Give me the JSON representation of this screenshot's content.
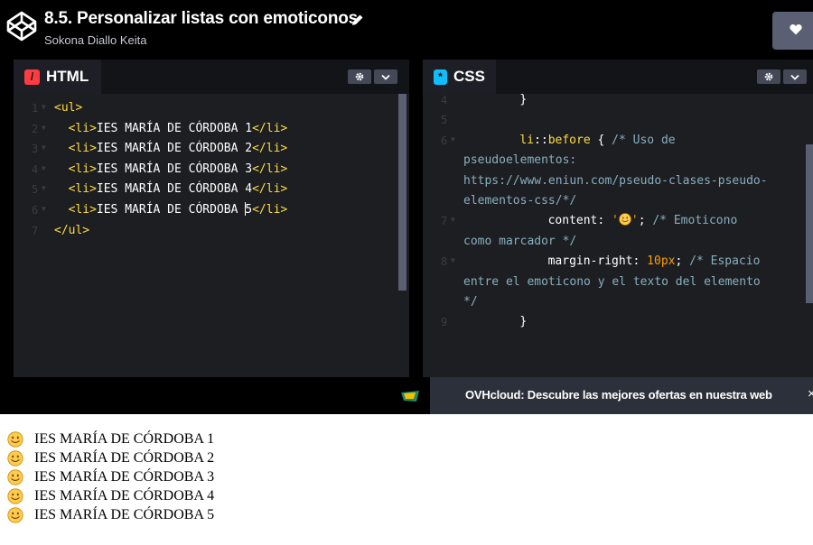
{
  "header": {
    "title": "8.5. Personalizar listas con emoticonos",
    "author": "Sokona Diallo Keita"
  },
  "html_panel": {
    "tab_label": "HTML",
    "icon_text": "/",
    "icon_color": "#ff3c41",
    "lines": [
      {
        "num": "1",
        "fold": true,
        "parts": [
          {
            "t": "<ul>",
            "c": "tag"
          }
        ],
        "indent": 0
      },
      {
        "num": "2",
        "fold": true,
        "parts": [
          {
            "t": "<li>",
            "c": "tag"
          },
          {
            "t": "IES MARÍA DE CÓRDOBA 1",
            "c": "val"
          },
          {
            "t": "</li>",
            "c": "tag"
          }
        ],
        "indent": 2
      },
      {
        "num": "3",
        "fold": true,
        "parts": [
          {
            "t": "<li>",
            "c": "tag"
          },
          {
            "t": "IES MARÍA DE CÓRDOBA 2",
            "c": "val"
          },
          {
            "t": "</li>",
            "c": "tag"
          }
        ],
        "indent": 2
      },
      {
        "num": "4",
        "fold": true,
        "parts": [
          {
            "t": "<li>",
            "c": "tag"
          },
          {
            "t": "IES MARÍA DE CÓRDOBA 3",
            "c": "val"
          },
          {
            "t": "</li>",
            "c": "tag"
          }
        ],
        "indent": 2
      },
      {
        "num": "5",
        "fold": true,
        "parts": [
          {
            "t": "<li>",
            "c": "tag"
          },
          {
            "t": "IES MARÍA DE CÓRDOBA 4",
            "c": "val"
          },
          {
            "t": "</li>",
            "c": "tag"
          }
        ],
        "indent": 2
      },
      {
        "num": "6",
        "fold": true,
        "parts": [
          {
            "t": "<li>",
            "c": "tag"
          },
          {
            "t": "IES MARÍA DE CÓRDOBA ",
            "c": "val"
          },
          {
            "t": "|",
            "c": "caret"
          },
          {
            "t": "5",
            "c": "val"
          },
          {
            "t": "</li>",
            "c": "tag"
          }
        ],
        "indent": 2
      },
      {
        "num": "7",
        "fold": false,
        "parts": [
          {
            "t": "</ul>",
            "c": "tag"
          }
        ],
        "indent": 0
      }
    ]
  },
  "css_panel": {
    "tab_label": "CSS",
    "icon_text": "*",
    "icon_color": "#0ebeff",
    "lines": [
      {
        "num": "4",
        "fold": false,
        "parts": [
          {
            "t": "}",
            "c": "val"
          }
        ],
        "indent": 8
      },
      {
        "num": "5",
        "fold": false,
        "parts": [],
        "indent": 0
      },
      {
        "num": "6",
        "fold": true,
        "parts": [
          {
            "t": "li",
            "c": "sel"
          },
          {
            "t": "::",
            "c": "val"
          },
          {
            "t": "before",
            "c": "sel"
          },
          {
            "t": " { ",
            "c": "val"
          },
          {
            "t": "/* Uso de",
            "c": "comment"
          }
        ],
        "indent": 8
      },
      {
        "num": "",
        "fold": false,
        "parts": [
          {
            "t": "pseudoelementos:",
            "c": "comment"
          }
        ],
        "indent": 0
      },
      {
        "num": "",
        "fold": false,
        "parts": [
          {
            "t": "https://www.eniun.com/pseudo-clases-pseudo-",
            "c": "comment"
          }
        ],
        "indent": 0
      },
      {
        "num": "",
        "fold": false,
        "parts": [
          {
            "t": "elementos-css/*/",
            "c": "comment"
          }
        ],
        "indent": 0
      },
      {
        "num": "7",
        "fold": true,
        "parts": [
          {
            "t": "content: ",
            "c": "prop"
          },
          {
            "t": "'",
            "c": "num"
          },
          {
            "t": "EMOJI",
            "c": "emoji"
          },
          {
            "t": "'",
            "c": "num"
          },
          {
            "t": "; ",
            "c": "val"
          },
          {
            "t": "/* Emoticono",
            "c": "comment"
          }
        ],
        "indent": 12
      },
      {
        "num": "",
        "fold": false,
        "parts": [
          {
            "t": "como marcador */",
            "c": "comment"
          }
        ],
        "indent": 0
      },
      {
        "num": "8",
        "fold": true,
        "parts": [
          {
            "t": "margin-right: ",
            "c": "prop"
          },
          {
            "t": "10px",
            "c": "num"
          },
          {
            "t": "; ",
            "c": "val"
          },
          {
            "t": "/* Espacio",
            "c": "comment"
          }
        ],
        "indent": 12
      },
      {
        "num": "",
        "fold": false,
        "parts": [
          {
            "t": "entre el emoticono y el texto del elemento",
            "c": "comment"
          }
        ],
        "indent": 0
      },
      {
        "num": "",
        "fold": false,
        "parts": [
          {
            "t": "*/",
            "c": "comment"
          }
        ],
        "indent": 0
      },
      {
        "num": "9",
        "fold": false,
        "parts": [
          {
            "t": "}",
            "c": "val"
          }
        ],
        "indent": 8
      }
    ]
  },
  "ad": {
    "text": "OVHcloud: Descubre las mejores ofertas en nuestra web",
    "close": "×"
  },
  "output": {
    "items": [
      "IES MARÍA DE CÓRDOBA 1",
      "IES MARÍA DE CÓRDOBA 2",
      "IES MARÍA DE CÓRDOBA 3",
      "IES MARÍA DE CÓRDOBA 4",
      "IES MARÍA DE CÓRDOBA 5"
    ]
  },
  "colors": {
    "tag": "#ffdd40",
    "comment": "#88afbf",
    "number": "#ff9e00",
    "heart_button": "#5a5f73"
  }
}
